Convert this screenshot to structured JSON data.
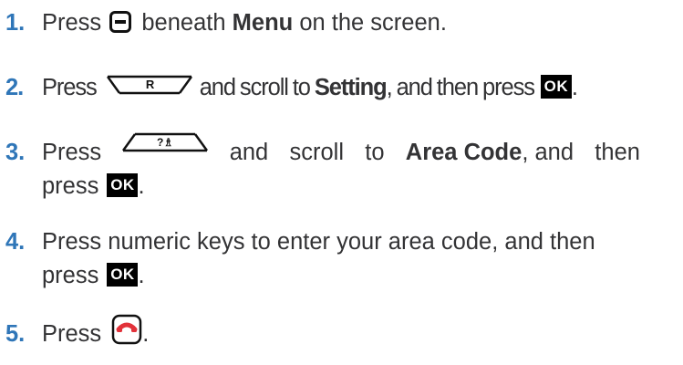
{
  "steps": [
    {
      "number": "1.",
      "press": "Press",
      "key_icon": "softkey-minus-icon",
      "text_after_key": "beneath",
      "bold": "Menu",
      "text_end": "on the screen."
    },
    {
      "number": "2.",
      "press": "Press",
      "key_icon": "nav-right-key-icon",
      "key_label": "R",
      "text_mid": "and scroll to",
      "bold": "Setting",
      "text_end": ", and then press",
      "ok_label": "OK",
      "period": "."
    },
    {
      "number": "3.",
      "press": "Press",
      "key_icon": "nav-up-contacts-key-icon",
      "key_label": "?♗",
      "word_and": "and",
      "word_scroll": "scroll",
      "word_to": "to",
      "bold": "Area Code",
      "word_and2": ", and",
      "word_then": "then",
      "line2_press": "press",
      "ok_label": "OK",
      "period": "."
    },
    {
      "number": "4.",
      "line1": "Press numeric keys to enter your area code, and then",
      "line2_press": "press",
      "ok_label": "OK",
      "period": "."
    },
    {
      "number": "5.",
      "press": "Press",
      "key_icon": "end-call-key-icon",
      "period": "."
    }
  ],
  "colors": {
    "step_number": "#2f76b8",
    "body_text": "#333335",
    "end_call_red": "#e2323a"
  }
}
